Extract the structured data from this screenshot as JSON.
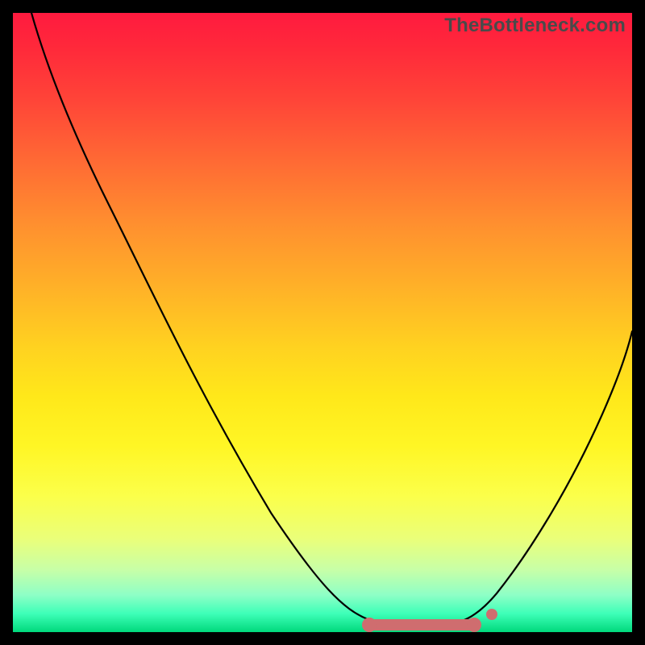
{
  "watermark": "TheBottleneck.com",
  "chart_data": {
    "type": "line",
    "title": "",
    "xlabel": "",
    "ylabel": "",
    "xlim": [
      0,
      100
    ],
    "ylim": [
      0,
      100
    ],
    "grid": false,
    "series": [
      {
        "name": "curve",
        "x": [
          3,
          8,
          14,
          20,
          26,
          32,
          38,
          44,
          50,
          55,
          58,
          62,
          66,
          70,
          74,
          78,
          83,
          88,
          92,
          96,
          100
        ],
        "y": [
          100,
          90,
          80,
          70,
          60,
          50,
          40,
          30,
          20,
          10,
          5,
          1,
          0.5,
          0.5,
          1,
          3,
          8,
          16,
          26,
          38,
          52
        ]
      }
    ],
    "annotations": {
      "bottom_marker_x_range": [
        57,
        76
      ],
      "bottom_marker_y": 0.5,
      "right_dot": {
        "x": 77,
        "y": 1.5
      }
    },
    "gradient_stops_pct": {
      "red": 0,
      "orange": 35,
      "yellow": 65,
      "green": 100
    }
  }
}
